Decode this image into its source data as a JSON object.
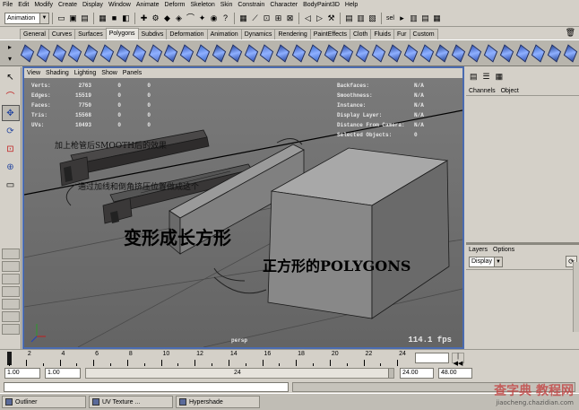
{
  "menubar": [
    "File",
    "Edit",
    "Modify",
    "Create",
    "Display",
    "Window",
    "Animate",
    "Deform",
    "Skeleton",
    "Skin",
    "Constrain",
    "Character",
    "BodyPaint3D",
    "Help"
  ],
  "statusline": {
    "mode": "Animation",
    "selection_label": "sel"
  },
  "shelf": {
    "tabs": [
      "General",
      "Curves",
      "Surfaces",
      "Polygons",
      "Subdivs",
      "Deformation",
      "Animation",
      "Dynamics",
      "Rendering",
      "PaintEffects",
      "Cloth",
      "Fluids",
      "Fur",
      "Custom"
    ],
    "active_tab": "Polygons",
    "icon_colors": [
      "#2f4fa8",
      "#3a5cc0",
      "#2f4fa8",
      "#3f66c8",
      "#2a4a9a",
      "#4070d0",
      "#2f4fa8",
      "#3a5cc0",
      "#5a7ad0",
      "#2f4fa8",
      "#3a5cc0",
      "#4070d0",
      "#2a4a9a",
      "#2f4fa8",
      "#3a5cc0",
      "#5a7ad0",
      "#2f4fa8",
      "#3a5cc0",
      "#4070d0",
      "#2a4a9a",
      "#2f4fa8",
      "#3a5cc0",
      "#5a7ad0",
      "#2f4fa8",
      "#3a5cc0",
      "#4070d0",
      "#2a4a9a",
      "#2f4fa8",
      "#3a5cc0",
      "#5a7ad0",
      "#2f4fa8",
      "#3a5cc0",
      "#4070d0",
      "#2a4a9a",
      "#2f4fa8"
    ]
  },
  "viewport": {
    "menu": [
      "View",
      "Shading",
      "Lighting",
      "Show",
      "Panels"
    ],
    "hud_left": [
      {
        "label": "Verts:",
        "value": "2763",
        "extra": "0",
        "extra2": "0"
      },
      {
        "label": "Edges:",
        "value": "15519",
        "extra": "0",
        "extra2": "0"
      },
      {
        "label": "Faces:",
        "value": "7750",
        "extra": "0",
        "extra2": "0"
      },
      {
        "label": "Tris:",
        "value": "15568",
        "extra": "0",
        "extra2": "0"
      },
      {
        "label": "UVs:",
        "value": "10493",
        "extra": "0",
        "extra2": "0"
      }
    ],
    "hud_right": [
      {
        "label": "Backfaces:",
        "value": "N/A"
      },
      {
        "label": "Smoothness:",
        "value": "N/A"
      },
      {
        "label": "Instance:",
        "value": "N/A"
      },
      {
        "label": "Display Layer:",
        "value": "N/A"
      },
      {
        "label": "Distance From Camera:",
        "value": "N/A"
      },
      {
        "label": "Selected Objects:",
        "value": "0"
      }
    ],
    "camera": "persp",
    "fps": "114.1 fps",
    "annotations": {
      "note1": "加上枪管后SMOOTH后的效果",
      "note2": "通过加线和倒角挤压位置做成这个",
      "big1": "变形成长方形",
      "big2": "正方形的POLYGONS"
    },
    "axis_label": "z x"
  },
  "right_panel": {
    "menu": [
      "Channels",
      "Object"
    ],
    "layers_menu": [
      "Layers",
      "Options"
    ],
    "layer_mode": "Display"
  },
  "timeline": {
    "ticks": [
      "2",
      "4",
      "6",
      "8",
      "10",
      "12",
      "14",
      "16",
      "18",
      "20",
      "22",
      "24"
    ],
    "current_frame": 1
  },
  "range": {
    "start": "1.00",
    "inner_start": "1.00",
    "thumb_label": "24",
    "inner_end": "24.00",
    "end": "48.00"
  },
  "taskbar": [
    "Outliner",
    "UV Texture ...",
    "Hypershade"
  ],
  "watermark": {
    "main": "查字典 教程网",
    "url": "jiaocheng.chazidian.com"
  },
  "colors": {
    "accent": "#4a6bb0",
    "viewport_bg": "#6e6e6e",
    "ui_bg": "#d4d0c8"
  }
}
